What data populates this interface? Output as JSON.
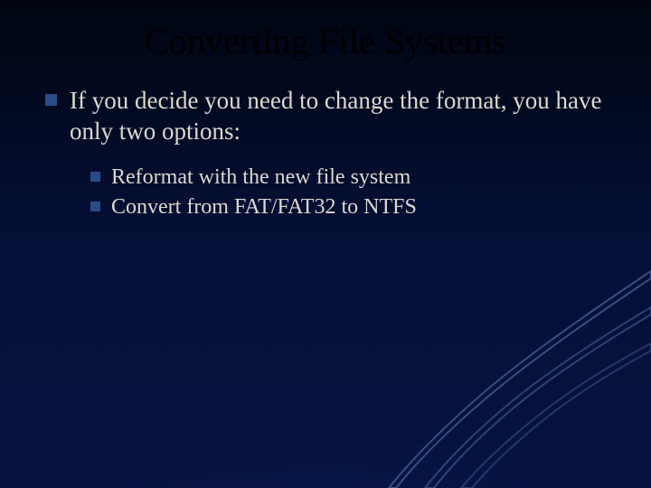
{
  "slide": {
    "title": "Converting File Systems",
    "bullets": {
      "main": "If you decide you need to change the format, you have only two options:",
      "sub1": "Reformat with the new file system",
      "sub2": "Convert from FAT/FAT32 to NTFS"
    }
  }
}
